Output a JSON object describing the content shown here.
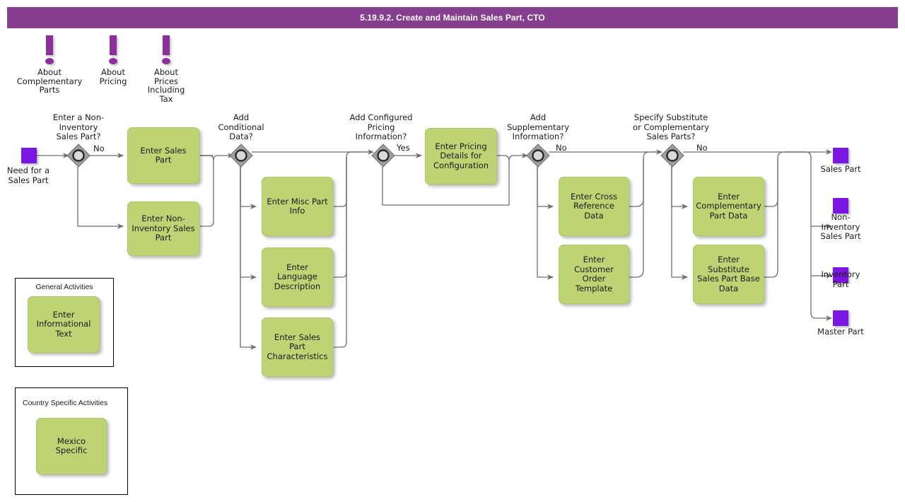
{
  "header": {
    "title": "5.19.9.2. Create and Maintain Sales Part, CTO",
    "bar_color": "#853f8e",
    "text_color": "#ffffff"
  },
  "palette": {
    "task_fill": "#bed373",
    "event_fill": "#7d16e0",
    "gateway_fill": "#9a9a9a",
    "note_fill": "#8d2f9a",
    "connector": "#6e6e6e"
  },
  "notes": [
    {
      "name": "about-complementary-parts",
      "label": "About\nComplementary\nParts"
    },
    {
      "name": "about-pricing",
      "label": "About\nPricing"
    },
    {
      "name": "about-prices-including-tax",
      "label": "About\nPrices\nIncluding\nTax"
    }
  ],
  "events": {
    "start": {
      "label": "Need for a\nSales Part"
    },
    "ends": [
      {
        "name": "sales-part",
        "label": "Sales Part"
      },
      {
        "name": "non-inventory-sales-part",
        "label": "Non-\nInventory\nSales Part"
      },
      {
        "name": "inventory-part",
        "label": "Inventory\nPart"
      },
      {
        "name": "master-part",
        "label": "Master Part"
      }
    ]
  },
  "gateways": [
    {
      "name": "enter-non-inventory-sales-part",
      "label": "Enter a Non-\nInventory\nSales Part?",
      "flow_label": "No"
    },
    {
      "name": "add-conditional-data",
      "label": "Add\nConditional\nData?",
      "flow_label": ""
    },
    {
      "name": "add-configured-pricing-information",
      "label": "Add Configured\nPricing\nInformation?",
      "flow_label": "Yes"
    },
    {
      "name": "add-supplementary-information",
      "label": "Add\nSupplementary\nInformation?",
      "flow_label": "No"
    },
    {
      "name": "specify-substitute-or-complementary-sales-parts",
      "label": "Specify Substitute\nor Complementary\nSales Parts?",
      "flow_label": "No"
    }
  ],
  "tasks": [
    {
      "name": "enter-sales-part",
      "label": "Enter Sales Part"
    },
    {
      "name": "enter-non-inventory-sales-part",
      "label": "Enter Non-\nInventory Sales\nPart"
    },
    {
      "name": "enter-misc-part-info",
      "label": "Enter Misc Part\nInfo"
    },
    {
      "name": "enter-language-description",
      "label": "Enter Language\nDescription"
    },
    {
      "name": "enter-sales-part-characteristics",
      "label": "Enter Sales Part\nCharacteristics"
    },
    {
      "name": "enter-pricing-details-for-configuration",
      "label": "Enter Pricing\nDetails for\nConfiguration"
    },
    {
      "name": "enter-cross-reference-data",
      "label": "Enter Cross\nReference Data"
    },
    {
      "name": "enter-customer-order-template",
      "label": "Enter Customer\nOrder Template"
    },
    {
      "name": "enter-complementary-part-data",
      "label": "Enter\nComplementary\nPart Data"
    },
    {
      "name": "enter-substitute-sales-part-base-data",
      "label": "Enter Substitute\nSales Part Base\nData"
    }
  ],
  "groups": [
    {
      "name": "general-activities",
      "title": "General Activities",
      "tasks": [
        {
          "name": "enter-informational-text",
          "label": "Enter\nInformational\nText"
        }
      ]
    },
    {
      "name": "country-specific-activities",
      "title": "Country Specific Activities",
      "tasks": [
        {
          "name": "mexico-specific",
          "label": "Mexico Specific"
        }
      ]
    }
  ]
}
